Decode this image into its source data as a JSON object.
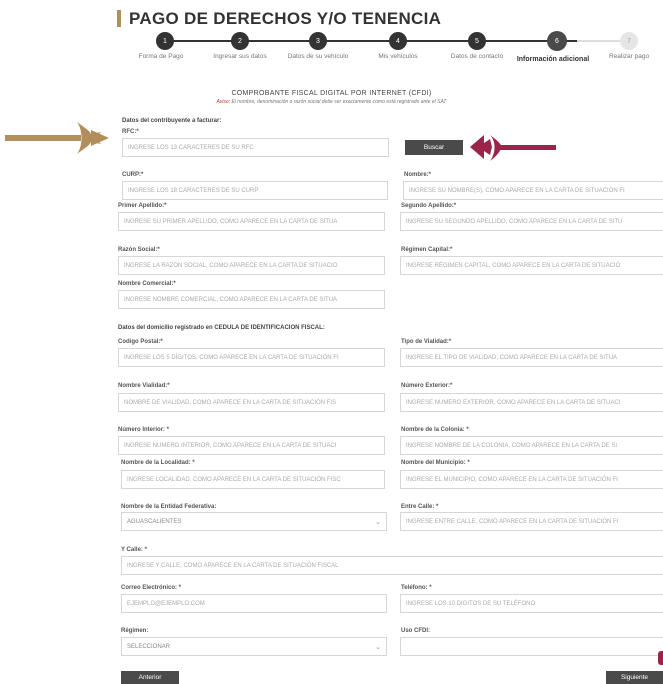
{
  "page": {
    "title": "PAGO DE DERECHOS Y/O TENENCIA"
  },
  "steps": [
    {
      "num": "1",
      "label": "Forma de Pago",
      "state": "done"
    },
    {
      "num": "2",
      "label": "Ingresar sus datos",
      "state": "done"
    },
    {
      "num": "3",
      "label": "Datos de su vehículo",
      "state": "done"
    },
    {
      "num": "4",
      "label": "Mis vehículos",
      "state": "done"
    },
    {
      "num": "5",
      "label": "Datos de contacto",
      "state": "done"
    },
    {
      "num": "6",
      "label": "Información adicional",
      "state": "current"
    },
    {
      "num": "7",
      "label": "Realizar pago",
      "state": "pending"
    }
  ],
  "cfdi": {
    "title": "COMPROBANTE FISCAL DIGITAL POR INTERNET (CFDI)",
    "note_warn": "Aviso:",
    "note_text": "El nombre, denominación o razón social debe ser exactamente como está registrado ante el SAT"
  },
  "sections": {
    "contribuyente": "Datos del contribuyente a facturar:",
    "domicilio": "Datos del domicilio registrado en CEDULA DE IDENTIFICACION FISCAL:"
  },
  "fields": {
    "rfc": {
      "label": "RFC:*",
      "placeholder": "INGRESE LOS 13 CARACTERES DE SU RFC"
    },
    "curp": {
      "label": "CURP:*",
      "placeholder": "INGRESE LOS 18 CARACTERES DE SU CURP"
    },
    "nombre": {
      "label": "Nombre:*",
      "placeholder": "INGRESE SU NOMBRE(S), COMO APARECE EN LA CARTA DE SITUACIÓN FI"
    },
    "primer_apellido": {
      "label": "Primer Apellido:*",
      "placeholder": "INGRESE SU PRIMER APELLIDO, COMO APARECE EN LA CARTA DE SITUA"
    },
    "segundo_apellido": {
      "label": "Segundo Apellido:*",
      "placeholder": "INGRESE SU SEGUNDO APELLIDO, COMO APARECE EN LA CARTA DE SITU"
    },
    "razon_social": {
      "label": "Razón Social:*",
      "placeholder": "INGRESE LA RAZÓN SOCIAL, COMO APARECE EN LA CARTA DE SITUACIO"
    },
    "regimen_capital": {
      "label": "Régimen Capital:*",
      "placeholder": "INGRESE RÉGIMEN CAPITAL, COMO APARECE EN LA CARTA DE SITUACIÓ"
    },
    "nombre_comercial": {
      "label": "Nombre Comercial:*",
      "placeholder": "INGRESE NOMBRE COMERCIAL, COMO APARECE EN LA CARTA DE SITUA"
    },
    "codigo_postal": {
      "label": "Codigo Postal:*",
      "placeholder": "INGRESE LOS 5 DÍGITOS, COMO APARECE EN LA CARTA DE SITUACIÓN FI"
    },
    "tipo_vialidad": {
      "label": "Tipo de Vialidad:*",
      "placeholder": "INGRESE EL TIPO DE VIALIDAD, COMO APARECE EN LA CARTA DE SITUA"
    },
    "nombre_vialidad": {
      "label": "Nombre Vialidad:*",
      "placeholder": "NOMBRE DE VIALIDAD, COMO APARECE EN LA CARTA DE SITUACIÓN FIS"
    },
    "numero_exterior": {
      "label": "Número Exterior:*",
      "placeholder": "INGRESE NUMERO EXTERIOR, COMO APARECE EN LA CARTA DE SITUACI"
    },
    "numero_interior": {
      "label": "Número Interior: *",
      "placeholder": "INGRESE NUMERO INTERIOR, COMO APARECE EN LA CARTA DE SITUACI"
    },
    "colonia": {
      "label": "Nombre de la Colonia: *",
      "placeholder": "INGRESE NOMBRE DE LA COLONIA, COMO APARECE EN LA CARTA DE SI"
    },
    "localidad": {
      "label": "Nombre de la Localidad: *",
      "placeholder": "INGRESE LOCALIDAD, COMO APARECE EN LA CARTA DE SITUACIÓN FISC"
    },
    "municipio": {
      "label": "Nombre del Municipio: *",
      "placeholder": "INGRESE EL MUNICIPIO, COMO APARECE EN LA CARTA DE SITUACIÓN FI"
    },
    "entidad": {
      "label": "Nombre de la Entidad Federativa:",
      "value": "AGUASCALIENTES"
    },
    "entre_calle": {
      "label": "Entre Calle: *",
      "placeholder": "INGRESE ENTRE CALLE, COMO APARECE EN LA CARTA DE SITUACIÓN FI"
    },
    "y_calle": {
      "label": "Y Calle: *",
      "placeholder": "INGRESE Y CALLE, COMO APARECE EN LA CARTA DE SITUACIÓN FISCAL"
    },
    "correo": {
      "label": "Correo Electrónico: *",
      "placeholder": "EJEMPLO@EJEMPLO.COM"
    },
    "telefono": {
      "label": "Teléfono: *",
      "placeholder": "INGRESE LOS 10 DIGITOS DE SU TELÉFONO"
    },
    "regimen": {
      "label": "Régimen:",
      "value": "SELECCIONAR"
    },
    "uso_cfdi": {
      "label": "Uso CFDI:",
      "value": ""
    }
  },
  "buttons": {
    "buscar": "Buscar",
    "anterior": "Anterior",
    "siguiente": "Siguiente"
  },
  "colors": {
    "gold": "#b38e5d",
    "maroon": "#9d2449",
    "dark": "#4a4a4a"
  }
}
